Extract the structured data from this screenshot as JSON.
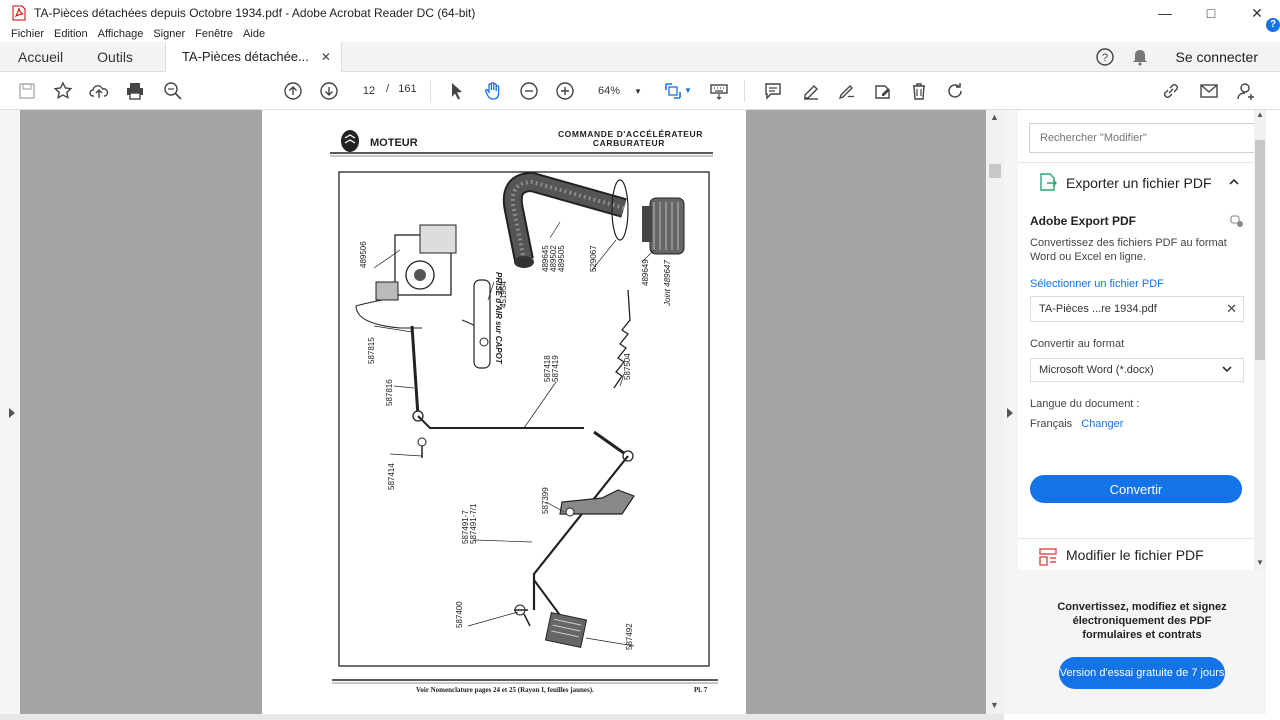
{
  "window": {
    "title": "TA-Pièces détachées depuis Octobre 1934.pdf - Adobe Acrobat Reader DC (64-bit)"
  },
  "menu": [
    "Fichier",
    "Edition",
    "Affichage",
    "Signer",
    "Fenêtre",
    "Aide"
  ],
  "tabs": {
    "home": "Accueil",
    "tools": "Outils",
    "doc": "TA-Pièces détachée...",
    "signin": "Se connecter"
  },
  "toolbar": {
    "page_current": "12",
    "page_sep": "/",
    "page_total": "161",
    "zoom": "64%"
  },
  "document": {
    "header_left": "MOTEUR",
    "header_right_1": "COMMANDE D'ACCÉLÉRATEUR",
    "header_right_2": "CARBURATEUR",
    "footer": "Voir Nomenclature pages 24 et 25 (Rayon I, feuilles jaunes).",
    "plate": "Pl. 7",
    "labels": {
      "l1": "489506",
      "l2": "PRISE d'AIR sur CAPOT",
      "l3": "489645",
      "l4": "489502",
      "l5": "489505",
      "l6": "529067",
      "l7": "489649",
      "l8": "Joint 489647",
      "l9": "451954",
      "l10": "587815",
      "l11": "587816",
      "l12": "587418",
      "l13": "587419",
      "l14": "587504",
      "l15": "587414",
      "l16": "587399",
      "l17": "587491-7",
      "l18": "587491-7/1",
      "l19": "587400",
      "l20": "587492"
    }
  },
  "panel": {
    "search_placeholder": "Rechercher \"Modifier\"",
    "export_title": "Exporter un fichier PDF",
    "adobe_export": "Adobe Export PDF",
    "desc": "Convertissez des fichiers PDF au format Word ou Excel en ligne.",
    "select_file": "Sélectionner un fichier PDF",
    "file_name": "TA-Pièces ...re 1934.pdf",
    "convert_to": "Convertir au format",
    "format": "Microsoft Word (*.docx)",
    "lang_label": "Langue du document :",
    "lang_value": "Français",
    "lang_change": "Changer",
    "convert_btn": "Convertir",
    "modify_title": "Modifier le fichier PDF",
    "promo_text": "Convertissez, modifiez et signez électroniquement des PDF formulaires et contrats",
    "promo_btn": "Version d'essai gratuite de 7 jours"
  },
  "colors": {
    "accent": "#1473e6",
    "viewer_bg": "#a5a5a5"
  }
}
